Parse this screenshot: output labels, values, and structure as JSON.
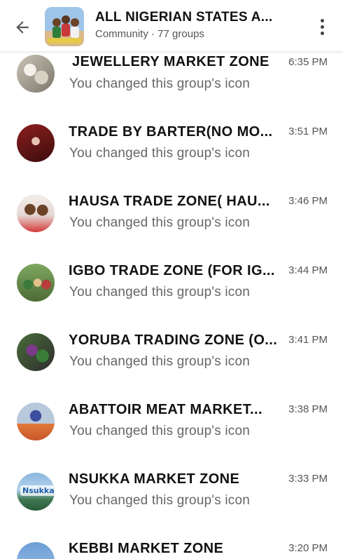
{
  "header": {
    "title": "ALL NIGERIAN STATES A...",
    "subtitle": "Community · 77 groups",
    "back_icon": "arrow-left-icon",
    "menu_icon": "more-vertical-icon"
  },
  "groups": [
    {
      "name": "JEWELLERY MARKET ZONE",
      "time": "6:35 PM",
      "message": "You changed this group's icon"
    },
    {
      "name": "TRADE BY BARTER(NO MO...",
      "time": "3:51 PM",
      "message": "You changed this group's icon"
    },
    {
      "name": "HAUSA TRADE ZONE( HAU...",
      "time": "3:46 PM",
      "message": "You changed this group's icon"
    },
    {
      "name": "IGBO TRADE ZONE (FOR IG...",
      "time": "3:44 PM",
      "message": "You changed this group's icon"
    },
    {
      "name": "YORUBA TRADING ZONE (O...",
      "time": "3:41 PM",
      "message": "You changed this group's icon"
    },
    {
      "name": "ABATTOIR MEAT MARKET...",
      "time": "3:38 PM",
      "message": "You changed this group's icon"
    },
    {
      "name": "NSUKKA MARKET ZONE",
      "time": "3:33 PM",
      "message": "You changed this group's icon",
      "avatar_text": "Nsukka"
    },
    {
      "name": "KEBBI MARKET ZONE",
      "time": "3:20 PM",
      "message": ""
    }
  ]
}
